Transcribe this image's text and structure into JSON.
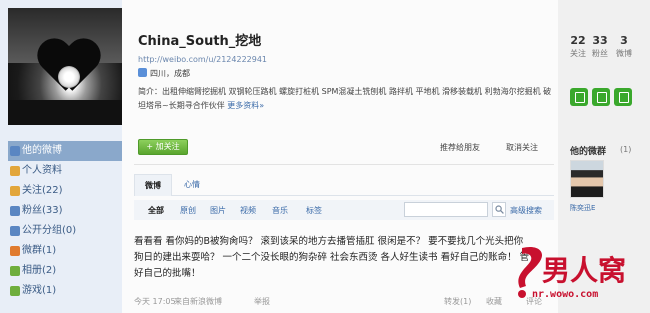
{
  "nav": {
    "items": [
      {
        "label": "他的微博",
        "color": "#5a86c2",
        "active": true
      },
      {
        "label": "个人资料",
        "color": "#e2a63b",
        "active": false
      },
      {
        "label": "关注(22)",
        "color": "#e2a63b",
        "active": false
      },
      {
        "label": "粉丝(33)",
        "color": "#5a86c2",
        "active": false
      },
      {
        "label": "公开分组(0)",
        "color": "#5a86c2",
        "active": false
      },
      {
        "label": "微群(1)",
        "color": "#e07b2f",
        "active": false
      },
      {
        "label": "相册(2)",
        "color": "#6fae3d",
        "active": false
      },
      {
        "label": "游戏(1)",
        "color": "#6fae3d",
        "active": false
      }
    ]
  },
  "profile": {
    "username": "China_South_挖地",
    "url": "http://weibo.com/u/2124222941",
    "location": "四川，成都",
    "bio": "简介：出租伸缩臂挖掘机 双钢轮压路机 螺旋打桩机 SPM混凝土铣刨机 路拌机 平地机 滑移装载机 利勃海尔挖掘机 破坦塔吊~长期寻合作伙伴 ",
    "bio_more": "更多资料»"
  },
  "actions": {
    "follow": "+ 加关注",
    "recommend": "推荐给朋友",
    "unfollow": "取消关注"
  },
  "tabs": [
    "微博",
    "心情"
  ],
  "filters": [
    "全部",
    "原创",
    "图片",
    "视频",
    "音乐",
    "标签"
  ],
  "search": {
    "advanced": "高级搜索"
  },
  "post": {
    "text": "看看看 看你妈的B被狗肏吗？ 滚到该呆的地方去播管插肛 很闲是不？ 要不要找几个光头把你狗日的建出来耍哈？ 一个二个没长眼的狗杂碎 社会东西烫 各人好生读书 看好自己的账命！ 管好自己的批嘴！",
    "time": "今天 17:05",
    "source": "来自新浪微博",
    "report": "举报",
    "repost": "转发(1)",
    "favorite": "收藏",
    "comment": "评论"
  },
  "stats": [
    {
      "num": "22",
      "label": "关注"
    },
    {
      "num": "33",
      "label": "粉丝"
    },
    {
      "num": "3",
      "label": "微博"
    }
  ],
  "group": {
    "title": "他的微群",
    "count": "(1)",
    "member": "陈奕迅E"
  },
  "watermark": {
    "logo": "男人窝",
    "url": "nr.wowo.com"
  }
}
